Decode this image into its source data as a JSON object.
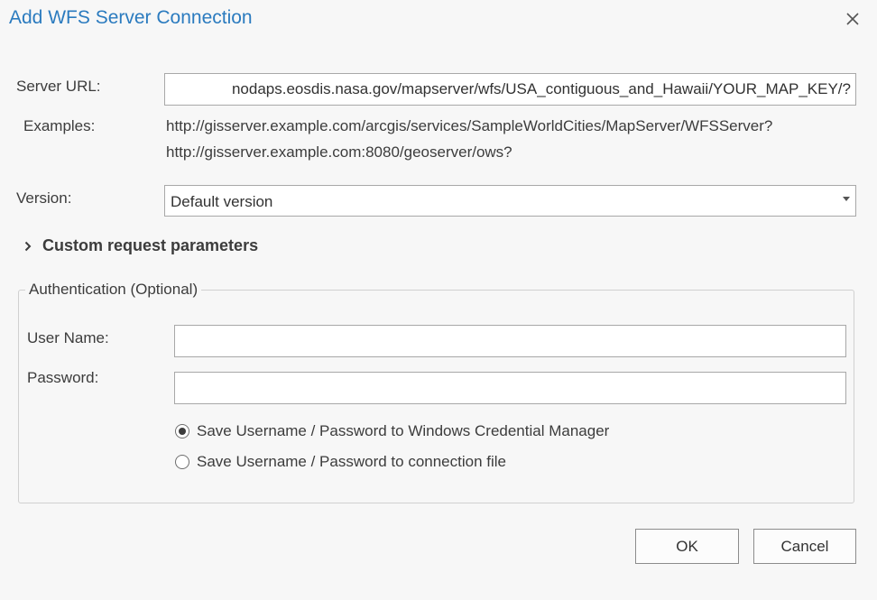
{
  "dialog": {
    "title": "Add WFS Server Connection",
    "close_icon": "close-icon"
  },
  "server_url": {
    "label": "Server URL:",
    "value": "nodaps.eosdis.nasa.gov/mapserver/wfs/USA_contiguous_and_Hawaii/YOUR_MAP_KEY/?"
  },
  "examples": {
    "label": "Examples:",
    "lines": [
      "http://gisserver.example.com/arcgis/services/SampleWorldCities/MapServer/WFSServer?",
      "http://gisserver.example.com:8080/geoserver/ows?"
    ]
  },
  "version": {
    "label": "Version:",
    "selected": "Default version",
    "icon": "chevron-down-icon"
  },
  "custom_params": {
    "label": "Custom request parameters",
    "icon": "chevron-right-icon"
  },
  "authentication": {
    "legend": "Authentication (Optional)",
    "username_label": "User Name:",
    "username_value": "",
    "password_label": "Password:",
    "password_value": "",
    "options": [
      {
        "label": "Save Username / Password to Windows Credential Manager",
        "checked": true
      },
      {
        "label": "Save Username / Password to connection file",
        "checked": false
      }
    ]
  },
  "buttons": {
    "ok": "OK",
    "cancel": "Cancel"
  },
  "colors": {
    "title": "#2b7bbf",
    "background": "#f7f7f7"
  }
}
